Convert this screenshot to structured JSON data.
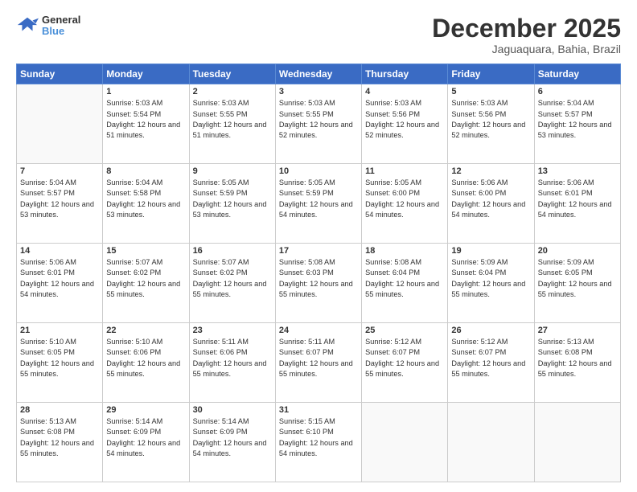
{
  "header": {
    "logo": {
      "line1": "General",
      "line2": "Blue"
    },
    "title": "December 2025",
    "location": "Jaguaquara, Bahia, Brazil"
  },
  "weekdays": [
    "Sunday",
    "Monday",
    "Tuesday",
    "Wednesday",
    "Thursday",
    "Friday",
    "Saturday"
  ],
  "weeks": [
    [
      {
        "day": "",
        "empty": true
      },
      {
        "day": "1",
        "rise": "5:03 AM",
        "set": "5:54 PM",
        "daylight": "12 hours and 51 minutes."
      },
      {
        "day": "2",
        "rise": "5:03 AM",
        "set": "5:55 PM",
        "daylight": "12 hours and 51 minutes."
      },
      {
        "day": "3",
        "rise": "5:03 AM",
        "set": "5:55 PM",
        "daylight": "12 hours and 52 minutes."
      },
      {
        "day": "4",
        "rise": "5:03 AM",
        "set": "5:56 PM",
        "daylight": "12 hours and 52 minutes."
      },
      {
        "day": "5",
        "rise": "5:03 AM",
        "set": "5:56 PM",
        "daylight": "12 hours and 52 minutes."
      },
      {
        "day": "6",
        "rise": "5:04 AM",
        "set": "5:57 PM",
        "daylight": "12 hours and 53 minutes."
      }
    ],
    [
      {
        "day": "7",
        "rise": "5:04 AM",
        "set": "5:57 PM",
        "daylight": "12 hours and 53 minutes."
      },
      {
        "day": "8",
        "rise": "5:04 AM",
        "set": "5:58 PM",
        "daylight": "12 hours and 53 minutes."
      },
      {
        "day": "9",
        "rise": "5:05 AM",
        "set": "5:59 PM",
        "daylight": "12 hours and 53 minutes."
      },
      {
        "day": "10",
        "rise": "5:05 AM",
        "set": "5:59 PM",
        "daylight": "12 hours and 54 minutes."
      },
      {
        "day": "11",
        "rise": "5:05 AM",
        "set": "6:00 PM",
        "daylight": "12 hours and 54 minutes."
      },
      {
        "day": "12",
        "rise": "5:06 AM",
        "set": "6:00 PM",
        "daylight": "12 hours and 54 minutes."
      },
      {
        "day": "13",
        "rise": "5:06 AM",
        "set": "6:01 PM",
        "daylight": "12 hours and 54 minutes."
      }
    ],
    [
      {
        "day": "14",
        "rise": "5:06 AM",
        "set": "6:01 PM",
        "daylight": "12 hours and 54 minutes."
      },
      {
        "day": "15",
        "rise": "5:07 AM",
        "set": "6:02 PM",
        "daylight": "12 hours and 55 minutes."
      },
      {
        "day": "16",
        "rise": "5:07 AM",
        "set": "6:02 PM",
        "daylight": "12 hours and 55 minutes."
      },
      {
        "day": "17",
        "rise": "5:08 AM",
        "set": "6:03 PM",
        "daylight": "12 hours and 55 minutes."
      },
      {
        "day": "18",
        "rise": "5:08 AM",
        "set": "6:04 PM",
        "daylight": "12 hours and 55 minutes."
      },
      {
        "day": "19",
        "rise": "5:09 AM",
        "set": "6:04 PM",
        "daylight": "12 hours and 55 minutes."
      },
      {
        "day": "20",
        "rise": "5:09 AM",
        "set": "6:05 PM",
        "daylight": "12 hours and 55 minutes."
      }
    ],
    [
      {
        "day": "21",
        "rise": "5:10 AM",
        "set": "6:05 PM",
        "daylight": "12 hours and 55 minutes."
      },
      {
        "day": "22",
        "rise": "5:10 AM",
        "set": "6:06 PM",
        "daylight": "12 hours and 55 minutes."
      },
      {
        "day": "23",
        "rise": "5:11 AM",
        "set": "6:06 PM",
        "daylight": "12 hours and 55 minutes."
      },
      {
        "day": "24",
        "rise": "5:11 AM",
        "set": "6:07 PM",
        "daylight": "12 hours and 55 minutes."
      },
      {
        "day": "25",
        "rise": "5:12 AM",
        "set": "6:07 PM",
        "daylight": "12 hours and 55 minutes."
      },
      {
        "day": "26",
        "rise": "5:12 AM",
        "set": "6:07 PM",
        "daylight": "12 hours and 55 minutes."
      },
      {
        "day": "27",
        "rise": "5:13 AM",
        "set": "6:08 PM",
        "daylight": "12 hours and 55 minutes."
      }
    ],
    [
      {
        "day": "28",
        "rise": "5:13 AM",
        "set": "6:08 PM",
        "daylight": "12 hours and 55 minutes."
      },
      {
        "day": "29",
        "rise": "5:14 AM",
        "set": "6:09 PM",
        "daylight": "12 hours and 54 minutes."
      },
      {
        "day": "30",
        "rise": "5:14 AM",
        "set": "6:09 PM",
        "daylight": "12 hours and 54 minutes."
      },
      {
        "day": "31",
        "rise": "5:15 AM",
        "set": "6:10 PM",
        "daylight": "12 hours and 54 minutes."
      },
      {
        "day": "",
        "empty": true
      },
      {
        "day": "",
        "empty": true
      },
      {
        "day": "",
        "empty": true
      }
    ]
  ],
  "labels": {
    "sunrise": "Sunrise:",
    "sunset": "Sunset:",
    "daylight": "Daylight:"
  }
}
